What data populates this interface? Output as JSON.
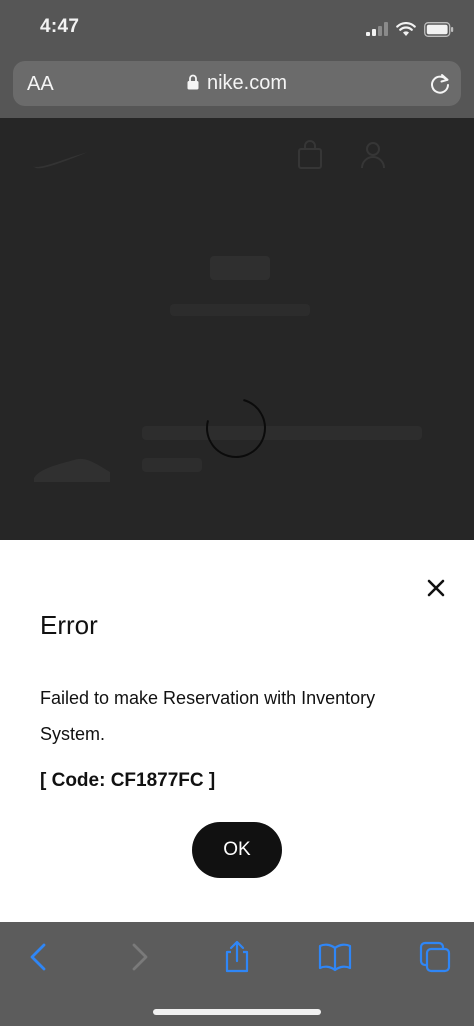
{
  "status_bar": {
    "time": "4:47"
  },
  "browser": {
    "text_size_label": "AA",
    "domain": "nike.com"
  },
  "modal": {
    "title": "Error",
    "message": "Failed to make Reservation with Inventory System.",
    "code": "[ Code: CF1877FC ]",
    "ok_label": "OK"
  },
  "colors": {
    "toolbar_icon_blue": "#2f86f6",
    "modal_button_bg": "#111111",
    "sheet_bg": "#ffffff"
  },
  "toolbar": {
    "icons": [
      "back-icon",
      "forward-icon",
      "share-icon",
      "bookmarks-icon",
      "tabs-icon"
    ]
  }
}
